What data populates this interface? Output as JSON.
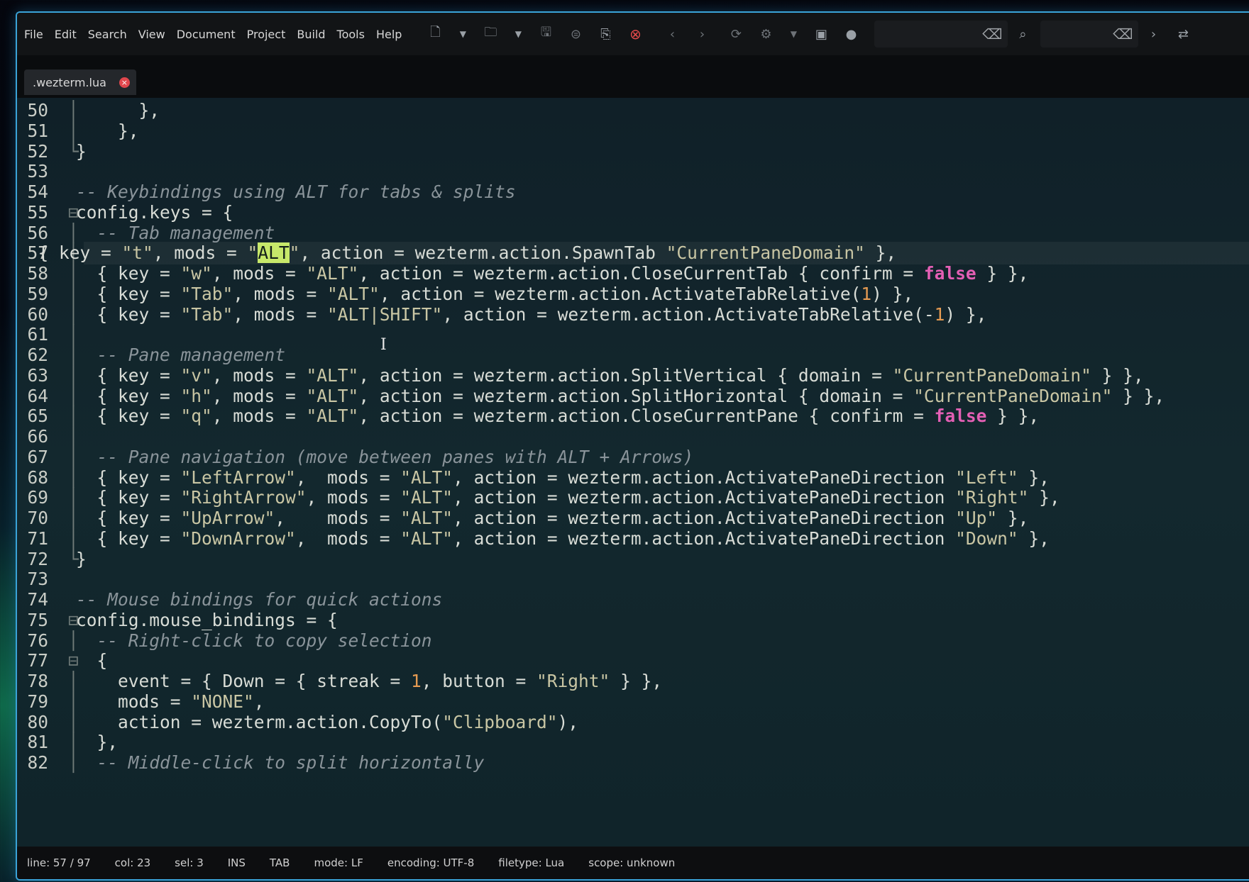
{
  "menu": [
    "File",
    "Edit",
    "Search",
    "View",
    "Document",
    "Project",
    "Build",
    "Tools",
    "Help"
  ],
  "toolbar_icons": [
    "new-file-icon",
    "dropdown-icon",
    "open-file-icon",
    "dropdown-icon",
    "save-icon",
    "save-all-icon",
    "revert-icon",
    "close-icon",
    "back-icon",
    "forward-icon",
    "reload-icon",
    "compile-icon",
    "dropdown-icon",
    "run-icon",
    "color-picker-icon",
    "clear-search-icon",
    "search-icon",
    "clear-goto-icon",
    "goto-icon",
    "more-icon"
  ],
  "tab": {
    "label": ".wezterm.lua"
  },
  "status": {
    "line": "line: 57 / 97",
    "col": "col: 23",
    "sel": "sel: 3",
    "ins": "INS",
    "tab": "TAB",
    "mode": "mode: LF",
    "encoding": "encoding: UTF-8",
    "filetype": "filetype: Lua",
    "scope": "scope: unknown"
  },
  "code_lines": [
    {
      "n": "50",
      "fold": "│",
      "text": "      },"
    },
    {
      "n": "51",
      "fold": "│",
      "text": "    },"
    },
    {
      "n": "52",
      "fold": "└",
      "text": "}"
    },
    {
      "n": "53",
      "fold": "",
      "text": ""
    },
    {
      "n": "54",
      "fold": "",
      "text": "-- Keybindings using ALT for tabs & splits"
    },
    {
      "n": "55",
      "fold": "⊟",
      "text": "config.keys = {"
    },
    {
      "n": "56",
      "fold": "│",
      "text": "  -- Tab management"
    },
    {
      "n": "57",
      "fold": "│",
      "text": "  { key = \"t\", mods = \"ALT\", action = wezterm.action.SpawnTab \"CurrentPaneDomain\" },"
    },
    {
      "n": "58",
      "fold": "│",
      "text": "  { key = \"w\", mods = \"ALT\", action = wezterm.action.CloseCurrentTab { confirm = false } },"
    },
    {
      "n": "59",
      "fold": "│",
      "text": "  { key = \"Tab\", mods = \"ALT\", action = wezterm.action.ActivateTabRelative(1) },"
    },
    {
      "n": "60",
      "fold": "│",
      "text": "  { key = \"Tab\", mods = \"ALT|SHIFT\", action = wezterm.action.ActivateTabRelative(-1) },"
    },
    {
      "n": "61",
      "fold": "│",
      "text": ""
    },
    {
      "n": "62",
      "fold": "│",
      "text": "  -- Pane management"
    },
    {
      "n": "63",
      "fold": "│",
      "text": "  { key = \"v\", mods = \"ALT\", action = wezterm.action.SplitVertical { domain = \"CurrentPaneDomain\" } },"
    },
    {
      "n": "64",
      "fold": "│",
      "text": "  { key = \"h\", mods = \"ALT\", action = wezterm.action.SplitHorizontal { domain = \"CurrentPaneDomain\" } },"
    },
    {
      "n": "65",
      "fold": "│",
      "text": "  { key = \"q\", mods = \"ALT\", action = wezterm.action.CloseCurrentPane { confirm = false } },"
    },
    {
      "n": "66",
      "fold": "│",
      "text": ""
    },
    {
      "n": "67",
      "fold": "│",
      "text": "  -- Pane navigation (move between panes with ALT + Arrows)"
    },
    {
      "n": "68",
      "fold": "│",
      "text": "  { key = \"LeftArrow\",  mods = \"ALT\", action = wezterm.action.ActivatePaneDirection \"Left\" },"
    },
    {
      "n": "69",
      "fold": "│",
      "text": "  { key = \"RightArrow\", mods = \"ALT\", action = wezterm.action.ActivatePaneDirection \"Right\" },"
    },
    {
      "n": "70",
      "fold": "│",
      "text": "  { key = \"UpArrow\",    mods = \"ALT\", action = wezterm.action.ActivatePaneDirection \"Up\" },"
    },
    {
      "n": "71",
      "fold": "│",
      "text": "  { key = \"DownArrow\",  mods = \"ALT\", action = wezterm.action.ActivatePaneDirection \"Down\" },"
    },
    {
      "n": "72",
      "fold": "└",
      "text": "}"
    },
    {
      "n": "73",
      "fold": "",
      "text": ""
    },
    {
      "n": "74",
      "fold": "",
      "text": "-- Mouse bindings for quick actions"
    },
    {
      "n": "75",
      "fold": "⊟",
      "text": "config.mouse_bindings = {"
    },
    {
      "n": "76",
      "fold": "│",
      "text": "  -- Right-click to copy selection"
    },
    {
      "n": "77",
      "fold": "⊟",
      "text": "  {"
    },
    {
      "n": "78",
      "fold": "│",
      "text": "    event = { Down = { streak = 1, button = \"Right\" } },"
    },
    {
      "n": "79",
      "fold": "│",
      "text": "    mods = \"NONE\","
    },
    {
      "n": "80",
      "fold": "│",
      "text": "    action = wezterm.action.CopyTo(\"Clipboard\"),"
    },
    {
      "n": "81",
      "fold": "│",
      "text": "  },"
    },
    {
      "n": "82",
      "fold": "│",
      "text": "  -- Middle-click to split horizontally"
    }
  ],
  "current_line": "57",
  "highlight_word": "ALT",
  "colors": {
    "comment": "#8a949a",
    "string": "#c9c6a4",
    "number": "#e49a52",
    "keyword": "#e35fb4",
    "highlight": "#c7e86a",
    "border": "#3aa3d8"
  }
}
